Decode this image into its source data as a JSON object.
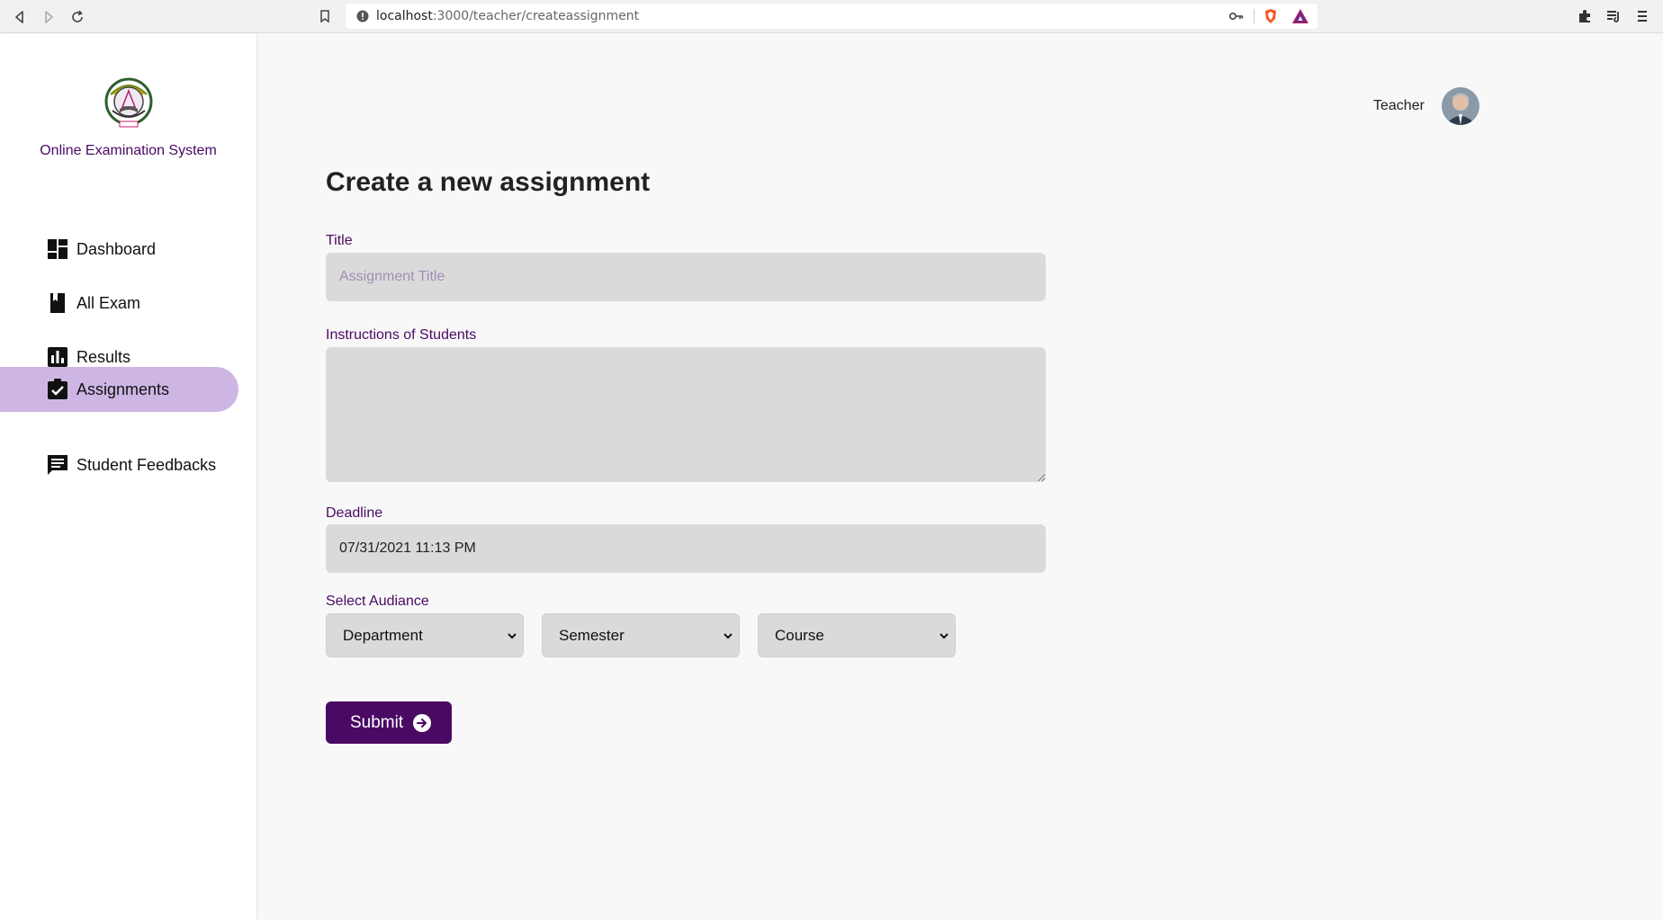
{
  "browser": {
    "url_host": "localhost",
    "url_rest": ":3000/teacher/createassignment"
  },
  "sidebar": {
    "app_name": "Online Examination System",
    "items": [
      {
        "label": "Dashboard",
        "icon": "dashboard-icon",
        "active": false
      },
      {
        "label": "All Exam",
        "icon": "book-icon",
        "active": false
      },
      {
        "label": "Results",
        "icon": "bar-chart-icon",
        "active": false
      },
      {
        "label": "Assignments",
        "icon": "assignment-check-icon",
        "active": true
      },
      {
        "label": "Student Feedbacks",
        "icon": "feedback-icon",
        "active": false
      }
    ]
  },
  "header": {
    "user_role": "Teacher"
  },
  "form": {
    "title": "Create a new assignment",
    "title_label": "Title",
    "title_placeholder": "Assignment Title",
    "instructions_label": "Instructions of Students",
    "deadline_label": "Deadline",
    "deadline_value": "07/31/2021 11:13 PM",
    "audience_label": "Select Audiance",
    "department": "Department",
    "semester": "Semester",
    "course": "Course",
    "submit_label": "Submit"
  },
  "colors": {
    "brand": "#4a0a63",
    "active_nav": "#cdb6e4",
    "input_bg": "#dadada"
  }
}
